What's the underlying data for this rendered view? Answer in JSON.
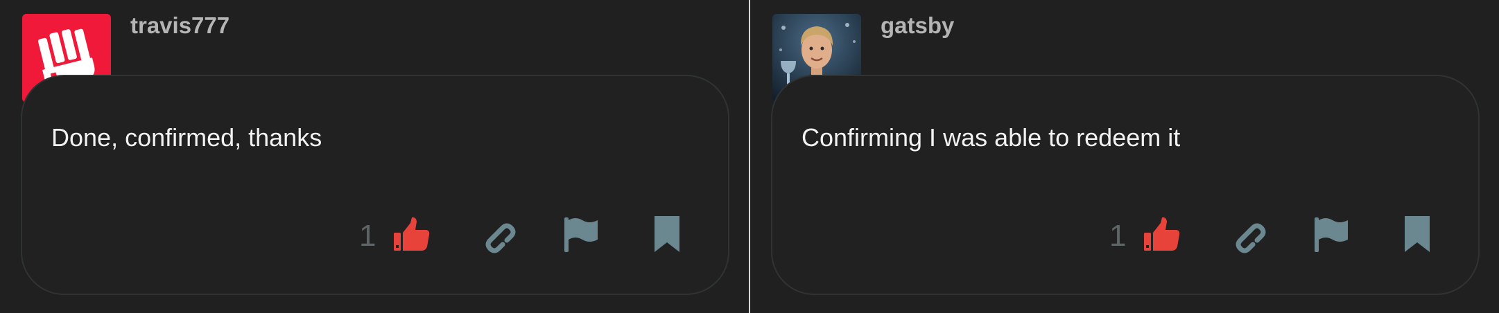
{
  "posts": [
    {
      "username": "travis777",
      "body": "Done, confirmed, thanks",
      "like_count": "1",
      "avatar": {
        "type": "logo",
        "bg": "#f0193a",
        "fg": "#ffffff"
      }
    },
    {
      "username": "gatsby",
      "body": "Confirming I was able to redeem it",
      "like_count": "1",
      "avatar": {
        "type": "photo"
      }
    }
  ],
  "icons": [
    "thumbs-up-icon",
    "link-icon",
    "flag-icon",
    "bookmark-icon"
  ],
  "colors": {
    "like": "#e8433a",
    "action": "#6b8890",
    "border": "#2f3433",
    "background": "#202020"
  }
}
